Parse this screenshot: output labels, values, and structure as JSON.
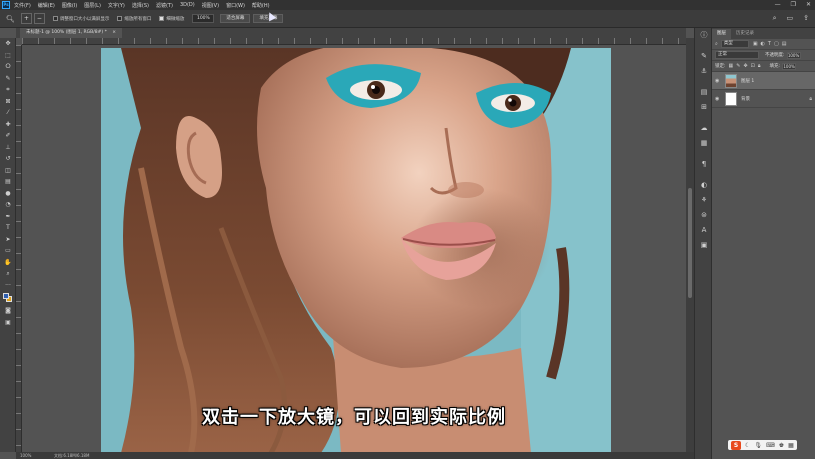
{
  "menu": {
    "logo": "Ps",
    "items": [
      "文件(F)",
      "编辑(E)",
      "图像(I)",
      "图层(L)",
      "文字(Y)",
      "选择(S)",
      "滤镜(T)",
      "3D(D)",
      "视图(V)",
      "窗口(W)",
      "帮助(H)"
    ]
  },
  "options": {
    "resize_windows": "调整窗口大小以满屏显示",
    "zoom_all": "缩放所有窗口",
    "scrubby_zoom": "细微缩放",
    "zoom_value": "100%",
    "fit_screen": "适合屏幕",
    "fill_screen": "填充屏幕"
  },
  "doc_tab": {
    "title": "未标题-1 @ 100% (图层 1, RGB/8#) *",
    "close": "×"
  },
  "subtitle": "双击一下放大镜，可以回到实际比例",
  "status": {
    "zoom": "100%",
    "doc_info": "文档:6.18M/6.18M"
  },
  "layers_panel": {
    "tabs": [
      "图层",
      "历史记录"
    ],
    "filter_label": "类型",
    "blend_mode": "正常",
    "opacity_label": "不透明度:",
    "opacity_value": "100%",
    "lock_label": "锁定:",
    "fill_label": "填充:",
    "fill_value": "100%",
    "layers": [
      {
        "name": "图层 1",
        "active": true
      },
      {
        "name": "背景",
        "active": false
      }
    ]
  },
  "tray": {
    "logo": "S"
  },
  "colors": {
    "foreground": "#2f5fb0",
    "background": "#e0a31a",
    "photo_bg": "#7bb9c3"
  }
}
